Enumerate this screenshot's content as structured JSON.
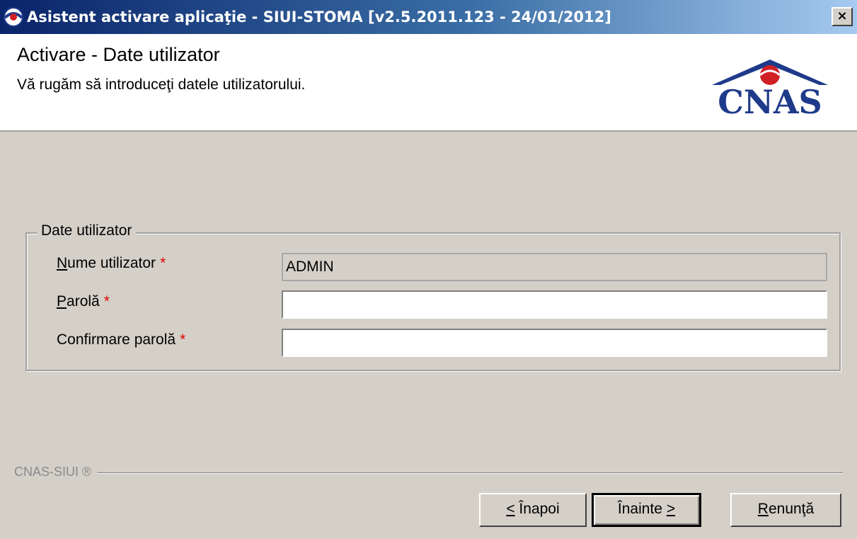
{
  "window": {
    "title": "Asistent activare aplicaţie - SIUI-STOMA [v2.5.2011.123 - 24/01/2012]",
    "close_label": "×",
    "app_icon": "cnas-app-icon"
  },
  "header": {
    "title": "Activare - Date utilizator",
    "subtitle": "Vă rugăm să introduceţi datele utilizatorului.",
    "logo_text": "CNAS"
  },
  "group": {
    "legend": "Date utilizator",
    "fields": [
      {
        "label_mnemonic": "N",
        "label_rest": "ume utilizator",
        "required": "*",
        "value": "ADMIN",
        "readonly": true
      },
      {
        "label_mnemonic": "P",
        "label_rest": "arolă",
        "required": "*",
        "value": "",
        "readonly": false
      },
      {
        "label_mnemonic": "",
        "label_rest": "Confirmare parolă",
        "required": "*",
        "value": "",
        "readonly": false
      }
    ]
  },
  "footer": {
    "label": "CNAS-SIUI ®"
  },
  "buttons": {
    "back_mnemonic": "<",
    "back_rest": " Înapoi",
    "next_label": "Înainte ",
    "next_mnemonic": ">",
    "cancel_mnemonic": "R",
    "cancel_rest": "enunţă"
  },
  "colors": {
    "titlebar_start": "#0a246a",
    "titlebar_end": "#a6caf0",
    "window_bg": "#d4d0c8",
    "required": "#e00000",
    "logo_blue": "#1e3a8a",
    "logo_red": "#d11f26"
  }
}
